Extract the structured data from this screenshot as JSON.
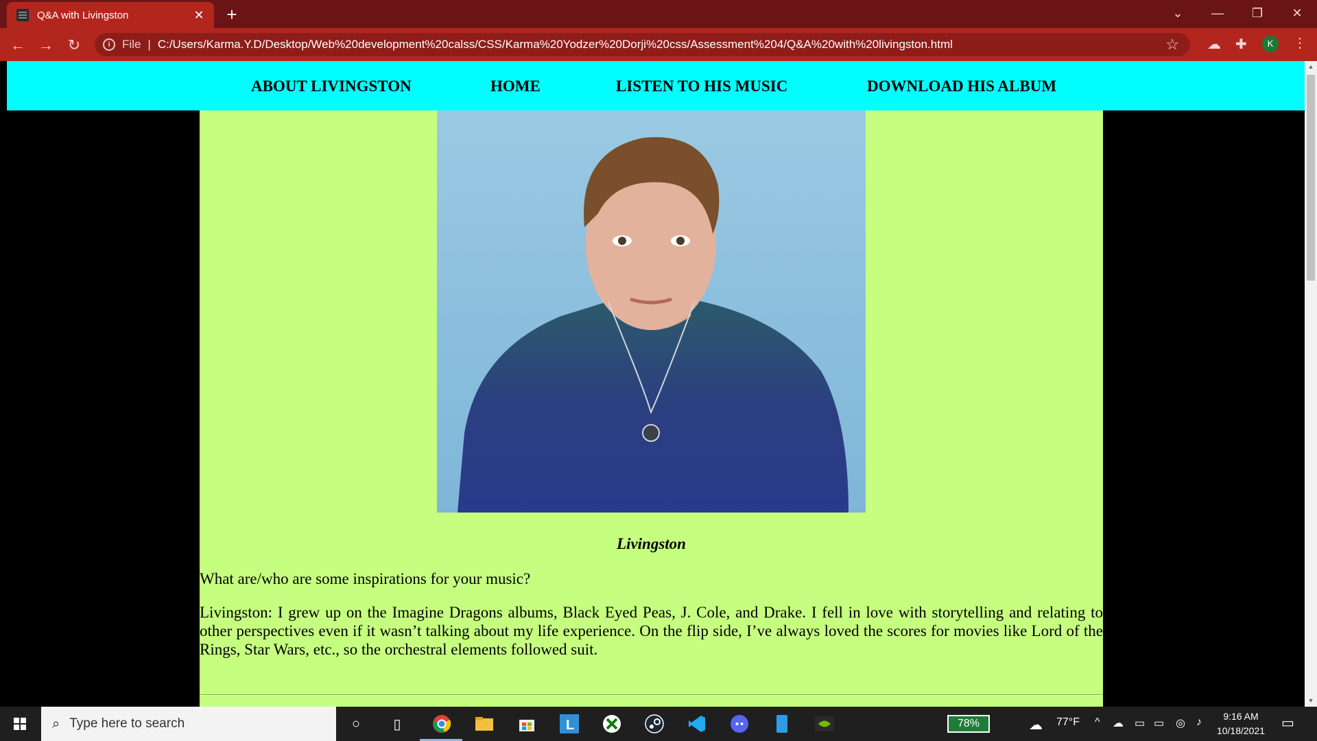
{
  "browser": {
    "tab_title": "Q&A with Livingston",
    "new_tab": "+",
    "file_label": "File",
    "url": "C:/Users/Karma.Y.D/Desktop/Web%20development%20calss/CSS/Karma%20Yodzer%20Dorji%20css/Assessment%204/Q&A%20with%20livingston.html",
    "profile_initial": "K"
  },
  "site": {
    "nav": [
      "ABOUT LIVINGSTON",
      "HOME",
      "LISTEN TO HIS MUSIC",
      "DOWNLOAD HIS ALBUM"
    ],
    "caption": "Livingston",
    "question": "What are/who are some inspirations for your music?",
    "answer": "Livingston: I grew up on the Imagine Dragons albums, Black Eyed Peas, J. Cole, and Drake. I fell in love with storytelling and relating to other perspectives even if it wasn’t talking about my life experience. On the flip side, I’ve always loved the scores for movies like Lord of the Rings, Star Wars, etc., so the orchestral elements followed suit."
  },
  "taskbar": {
    "search_placeholder": "Type here to search",
    "battery": "78%",
    "weather": "77°F",
    "time": "9:16 AM",
    "date": "10/18/2021"
  },
  "colors": {
    "chrome_dark": "#6b1416",
    "chrome_accent": "#b3261e",
    "nav_bg": "#00ffff",
    "content_bg": "#c6ff80"
  }
}
